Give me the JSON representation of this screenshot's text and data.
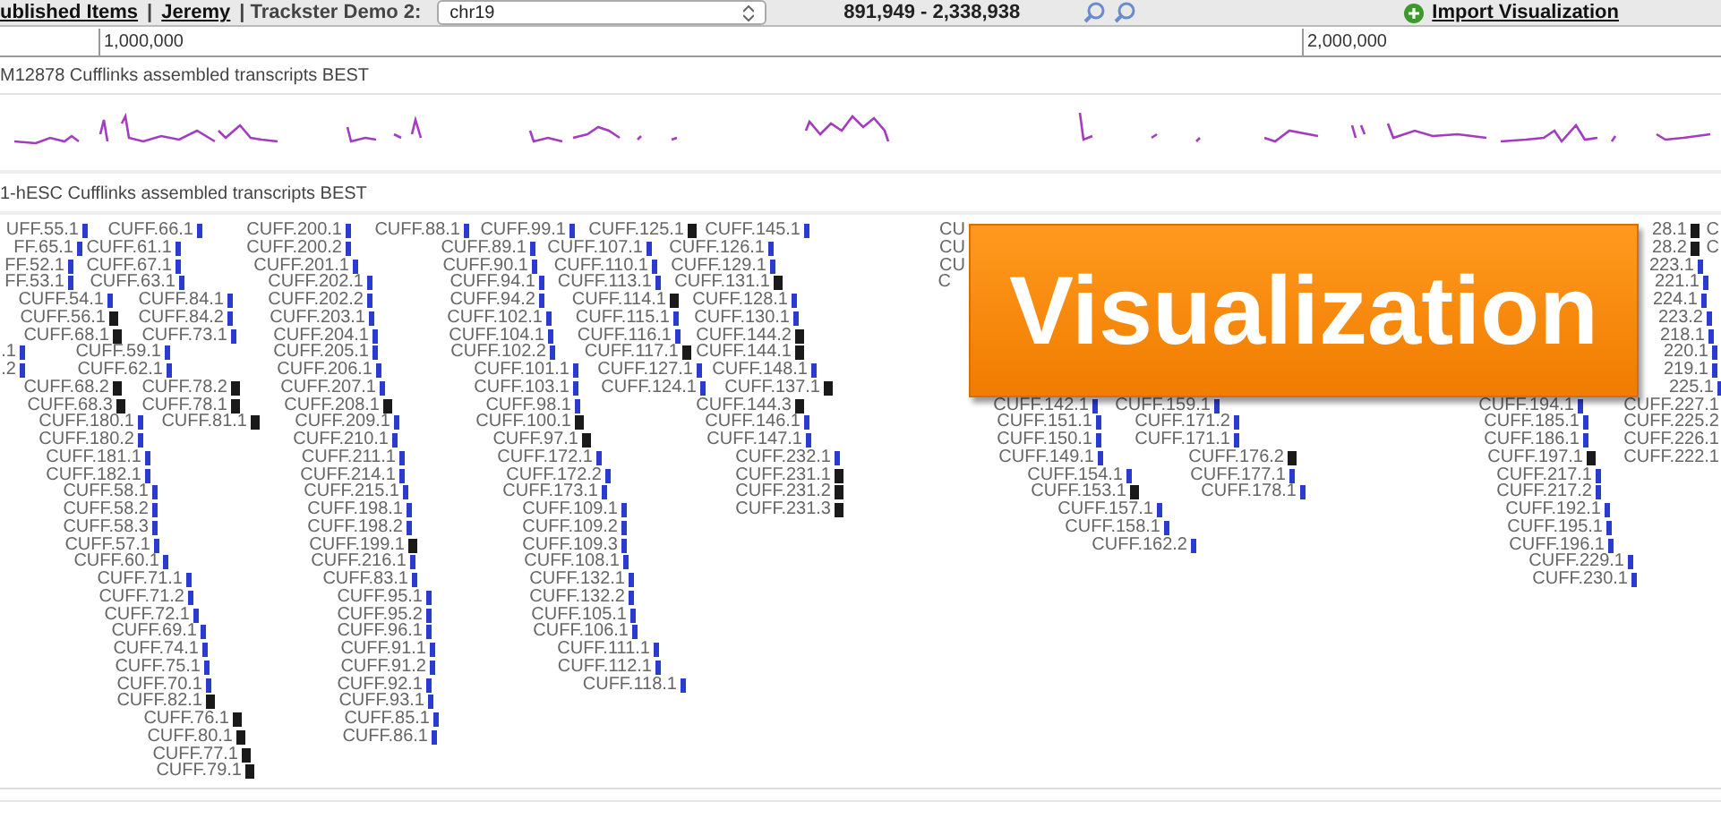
{
  "header": {
    "breadcrumbs": [
      {
        "text": "ublished Items",
        "link": true
      },
      {
        "text": "|",
        "link": false
      },
      {
        "text": "Jeremy",
        "link": true
      },
      {
        "text": "| Trackster Demo 2:",
        "link": false
      }
    ],
    "chromosome": "chr19",
    "range": "891,949 - 2,338,938",
    "import_link": "Import Visualization"
  },
  "ruler": {
    "ticks": [
      "1,000,000",
      "2,000,000"
    ]
  },
  "tracks": [
    {
      "kind": "coverage",
      "name": "M12878 Cufflinks assembled transcripts BEST"
    },
    {
      "kind": "features",
      "name": "1-hESC Cufflinks assembled transcripts BEST",
      "feature_columns": [
        [
          {
            "label": "UFF.55.1",
            "color": "#2a3bd0"
          },
          {
            "label": "FF.65.1",
            "color": "#2a3bd0"
          },
          {
            "label": "FF.52.1",
            "color": "#2a3bd0"
          },
          {
            "label": "FF.53.1",
            "color": "#2a3bd0"
          },
          {
            "label": "CUFF.54.1",
            "color": "#2a3bd0"
          },
          {
            "label": "CUFF.56.1",
            "color": "#1a1a1a"
          },
          {
            "label": "CUFF.68.1",
            "color": "#1a1a1a"
          },
          {
            "label": ".1",
            "color": "#2a3bd0"
          },
          {
            "label": ".2",
            "color": "#2a3bd0"
          },
          {
            "label": "CUFF.68.2",
            "color": "#1a1a1a"
          },
          {
            "label": "CUFF.68.3",
            "color": "#1a1a1a"
          },
          {
            "label": "CUFF.180.1",
            "color": "#2a3bd0"
          },
          {
            "label": "CUFF.180.2",
            "color": "#2a3bd0"
          },
          {
            "label": "CUFF.181.1",
            "color": "#2a3bd0"
          },
          {
            "label": "CUFF.182.1",
            "color": "#2a3bd0"
          },
          {
            "label": "CUFF.58.1",
            "color": "#2a3bd0"
          },
          {
            "label": "CUFF.58.2",
            "color": "#2a3bd0"
          },
          {
            "label": "CUFF.58.3",
            "color": "#2a3bd0"
          },
          {
            "label": "CUFF.57.1",
            "color": "#2a3bd0"
          },
          {
            "label": "CUFF.60.1",
            "color": "#2a3bd0"
          },
          {
            "label": "CUFF.71.1",
            "color": "#2a3bd0"
          },
          {
            "label": "CUFF.71.2",
            "color": "#2a3bd0"
          },
          {
            "label": "CUFF.72.1",
            "color": "#2a3bd0"
          },
          {
            "label": "CUFF.69.1",
            "color": "#2a3bd0"
          },
          {
            "label": "CUFF.74.1",
            "color": "#2a3bd0"
          },
          {
            "label": "CUFF.75.1",
            "color": "#2a3bd0"
          },
          {
            "label": "CUFF.70.1",
            "color": "#2a3bd0"
          },
          {
            "label": "CUFF.82.1",
            "color": "#1a1a1a"
          },
          {
            "label": "CUFF.76.1",
            "color": "#1a1a1a"
          },
          {
            "label": "CUFF.80.1",
            "color": "#1a1a1a"
          },
          {
            "label": "CUFF.77.1",
            "color": "#1a1a1a"
          },
          {
            "label": "CUFF.79.1",
            "color": "#1a1a1a"
          }
        ],
        [
          {
            "label": "CUFF.66.1",
            "color": "#2a3bd0"
          },
          {
            "label": "CUFF.61.1",
            "color": "#2a3bd0"
          },
          {
            "label": "CUFF.67.1",
            "color": "#2a3bd0"
          },
          {
            "label": "CUFF.63.1",
            "color": "#2a3bd0"
          },
          {
            "label": "CUFF.84.1",
            "color": "#2a3bd0"
          },
          {
            "label": "CUFF.84.2",
            "color": "#2a3bd0"
          },
          {
            "label": "CUFF.73.1",
            "color": "#2a3bd0"
          },
          {
            "label": "CUFF.59.1",
            "color": "#2a3bd0"
          },
          {
            "label": "CUFF.62.1",
            "color": "#2a3bd0"
          },
          {
            "label": "CUFF.78.2",
            "color": "#1a1a1a"
          },
          {
            "label": "CUFF.78.1",
            "color": "#1a1a1a"
          },
          {
            "label": "CUFF.81.1",
            "color": "#1a1a1a"
          }
        ],
        [
          {
            "label": "CUFF.200.1",
            "color": "#2a3bd0"
          },
          {
            "label": "CUFF.200.2",
            "color": "#2a3bd0"
          },
          {
            "label": "CUFF.201.1",
            "color": "#2a3bd0"
          },
          {
            "label": "CUFF.202.1",
            "color": "#2a3bd0"
          },
          {
            "label": "CUFF.202.2",
            "color": "#2a3bd0"
          },
          {
            "label": "CUFF.203.1",
            "color": "#2a3bd0"
          },
          {
            "label": "CUFF.204.1",
            "color": "#2a3bd0"
          },
          {
            "label": "CUFF.205.1",
            "color": "#2a3bd0"
          },
          {
            "label": "CUFF.206.1",
            "color": "#2a3bd0"
          },
          {
            "label": "CUFF.207.1",
            "color": "#2a3bd0"
          },
          {
            "label": "CUFF.208.1",
            "color": "#1a1a1a"
          },
          {
            "label": "CUFF.209.1",
            "color": "#2a3bd0"
          },
          {
            "label": "CUFF.210.1",
            "color": "#2a3bd0"
          },
          {
            "label": "CUFF.211.1",
            "color": "#2a3bd0"
          },
          {
            "label": "CUFF.214.1",
            "color": "#2a3bd0"
          },
          {
            "label": "CUFF.215.1",
            "color": "#2a3bd0"
          },
          {
            "label": "CUFF.198.1",
            "color": "#2a3bd0"
          },
          {
            "label": "CUFF.198.2",
            "color": "#2a3bd0"
          },
          {
            "label": "CUFF.199.1",
            "color": "#1a1a1a"
          },
          {
            "label": "CUFF.216.1",
            "color": "#2a3bd0"
          },
          {
            "label": "CUFF.83.1",
            "color": "#2a3bd0"
          },
          {
            "label": "CUFF.95.1",
            "color": "#2a3bd0"
          },
          {
            "label": "CUFF.95.2",
            "color": "#2a3bd0"
          },
          {
            "label": "CUFF.96.1",
            "color": "#2a3bd0"
          },
          {
            "label": "CUFF.91.1",
            "color": "#2a3bd0"
          },
          {
            "label": "CUFF.91.2",
            "color": "#2a3bd0"
          },
          {
            "label": "CUFF.92.1",
            "color": "#2a3bd0"
          },
          {
            "label": "CUFF.93.1",
            "color": "#2a3bd0"
          },
          {
            "label": "CUFF.85.1",
            "color": "#2a3bd0"
          },
          {
            "label": "CUFF.86.1",
            "color": "#2a3bd0"
          }
        ],
        [
          {
            "label": "CUFF.88.1",
            "color": "#2a3bd0"
          },
          {
            "label": "CUFF.89.1",
            "color": "#2a3bd0"
          },
          {
            "label": "CUFF.90.1",
            "color": "#2a3bd0"
          },
          {
            "label": "CUFF.94.1",
            "color": "#2a3bd0"
          },
          {
            "label": "CUFF.94.2",
            "color": "#2a3bd0"
          },
          {
            "label": "CUFF.102.1",
            "color": "#2a3bd0"
          },
          {
            "label": "CUFF.104.1",
            "color": "#2a3bd0"
          },
          {
            "label": "CUFF.102.2",
            "color": "#2a3bd0"
          },
          {
            "label": "CUFF.101.1",
            "color": "#2a3bd0"
          },
          {
            "label": "CUFF.103.1",
            "color": "#2a3bd0"
          },
          {
            "label": "CUFF.98.1",
            "color": "#2a3bd0"
          },
          {
            "label": "CUFF.100.1",
            "color": "#1a1a1a"
          },
          {
            "label": "CUFF.97.1",
            "color": "#1a1a1a"
          },
          {
            "label": "CUFF.172.1",
            "color": "#2a3bd0"
          },
          {
            "label": "CUFF.172.2",
            "color": "#2a3bd0"
          },
          {
            "label": "CUFF.173.1",
            "color": "#2a3bd0"
          },
          {
            "label": "CUFF.109.1",
            "color": "#2a3bd0"
          },
          {
            "label": "CUFF.109.2",
            "color": "#2a3bd0"
          },
          {
            "label": "CUFF.109.3",
            "color": "#2a3bd0"
          },
          {
            "label": "CUFF.108.1",
            "color": "#2a3bd0"
          },
          {
            "label": "CUFF.132.1",
            "color": "#2a3bd0"
          },
          {
            "label": "CUFF.132.2",
            "color": "#2a3bd0"
          },
          {
            "label": "CUFF.105.1",
            "color": "#2a3bd0"
          },
          {
            "label": "CUFF.106.1",
            "color": "#2a3bd0"
          },
          {
            "label": "CUFF.111.1",
            "color": "#2a3bd0"
          },
          {
            "label": "CUFF.112.1",
            "color": "#2a3bd0"
          },
          {
            "label": "CUFF.118.1",
            "color": "#2a3bd0"
          }
        ],
        [
          {
            "label": "CUFF.99.1",
            "color": "#2a3bd0"
          },
          {
            "label": "CUFF.107.1",
            "color": "#2a3bd0"
          },
          {
            "label": "CUFF.110.1",
            "color": "#2a3bd0"
          },
          {
            "label": "CUFF.113.1",
            "color": "#2a3bd0"
          },
          {
            "label": "CUFF.114.1",
            "color": "#1a1a1a"
          },
          {
            "label": "CUFF.115.1",
            "color": "#2a3bd0"
          },
          {
            "label": "CUFF.116.1",
            "color": "#2a3bd0"
          },
          {
            "label": "CUFF.117.1",
            "color": "#1a1a1a"
          },
          {
            "label": "CUFF.127.1",
            "color": "#2a3bd0"
          },
          {
            "label": "CUFF.124.1",
            "color": "#2a3bd0"
          }
        ],
        [
          {
            "label": "CUFF.125.1",
            "color": "#1a1a1a"
          }
        ],
        [
          {
            "label": "CUFF.145.1",
            "color": "#2a3bd0"
          },
          {
            "label": "CUFF.126.1",
            "color": "#2a3bd0"
          },
          {
            "label": "CUFF.129.1",
            "color": "#2a3bd0"
          },
          {
            "label": "CUFF.131.1",
            "color": "#1a1a1a"
          },
          {
            "label": "CUFF.128.1",
            "color": "#2a3bd0"
          },
          {
            "label": "CUFF.130.1",
            "color": "#2a3bd0"
          },
          {
            "label": "CUFF.144.2",
            "color": "#1a1a1a"
          },
          {
            "label": "CUFF.144.1",
            "color": "#1a1a1a"
          },
          {
            "label": "CUFF.148.1",
            "color": "#2a3bd0"
          },
          {
            "label": "CUFF.137.1",
            "color": "#1a1a1a"
          },
          {
            "label": "CUFF.144.3",
            "color": "#1a1a1a"
          },
          {
            "label": "CUFF.146.1",
            "color": "#2a3bd0"
          },
          {
            "label": "CUFF.147.1",
            "color": "#2a3bd0"
          },
          {
            "label": "CUFF.232.1",
            "color": "#2a3bd0"
          },
          {
            "label": "CUFF.231.1",
            "color": "#1a1a1a"
          },
          {
            "label": "CUFF.231.2",
            "color": "#1a1a1a"
          },
          {
            "label": "CUFF.231.3",
            "color": "#1a1a1a"
          }
        ],
        [
          {
            "label": "CU"
          },
          {
            "label": "CU"
          },
          {
            "label": "CU"
          },
          {
            "label": "C"
          }
        ],
        [
          {
            "label": "CUFF.142.1",
            "color": "#2a3bd0"
          },
          {
            "label": "CUFF.151.1",
            "color": "#2a3bd0"
          },
          {
            "label": "CUFF.150.1",
            "color": "#2a3bd0"
          },
          {
            "label": "CUFF.149.1",
            "color": "#2a3bd0"
          },
          {
            "label": "CUFF.154.1",
            "color": "#2a3bd0"
          },
          {
            "label": "CUFF.153.1",
            "color": "#1a1a1a"
          },
          {
            "label": "CUFF.157.1",
            "color": "#2a3bd0"
          },
          {
            "label": "CUFF.158.1",
            "color": "#2a3bd0"
          },
          {
            "label": "CUFF.162.2",
            "color": "#2a3bd0"
          }
        ],
        [
          {
            "label": "CUFF.159.1",
            "color": "#2a3bd0"
          },
          {
            "label": "CUFF.171.2",
            "color": "#2a3bd0"
          },
          {
            "label": "CUFF.171.1",
            "color": "#2a3bd0"
          },
          {
            "label": "CUFF.176.2",
            "color": "#1a1a1a"
          },
          {
            "label": "CUFF.177.1",
            "color": "#2a3bd0"
          },
          {
            "label": "CUFF.178.1",
            "color": "#2a3bd0"
          }
        ],
        [
          {
            "label": "CUFF.194.1",
            "color": "#2a3bd0"
          },
          {
            "label": "CUFF.185.1",
            "color": "#2a3bd0"
          },
          {
            "label": "CUFF.186.1",
            "color": "#2a3bd0"
          },
          {
            "label": "CUFF.197.1",
            "color": "#1a1a1a"
          },
          {
            "label": "CUFF.217.1",
            "color": "#2a3bd0"
          },
          {
            "label": "CUFF.217.2",
            "color": "#2a3bd0"
          },
          {
            "label": "CUFF.192.1",
            "color": "#2a3bd0"
          },
          {
            "label": "CUFF.195.1",
            "color": "#2a3bd0"
          },
          {
            "label": "CUFF.196.1",
            "color": "#2a3bd0"
          },
          {
            "label": "CUFF.229.1",
            "color": "#2a3bd0"
          },
          {
            "label": "CUFF.230.1",
            "color": "#2a3bd0"
          }
        ],
        [
          {
            "label": "28.1",
            "color": "#1a1a1a"
          },
          {
            "label": "28.2",
            "color": "#1a1a1a"
          },
          {
            "label": "223.1",
            "color": "#2a3bd0"
          },
          {
            "label": "221.1",
            "color": "#2a3bd0"
          },
          {
            "label": "224.1",
            "color": "#2a3bd0"
          },
          {
            "label": "223.2",
            "color": "#2a3bd0"
          },
          {
            "label": "218.1",
            "color": "#2a3bd0"
          },
          {
            "label": "220.1",
            "color": "#2a3bd0"
          },
          {
            "label": "219.1",
            "color": "#2a3bd0"
          },
          {
            "label": "225.1",
            "color": "#2a3bd0"
          },
          {
            "label": "CUFF.227.1"
          },
          {
            "label": "CUFF.225.2"
          },
          {
            "label": "CUFF.226.1"
          },
          {
            "label": "CUFF.222.1"
          }
        ],
        [
          {
            "label": "C"
          },
          {
            "label": "C"
          }
        ]
      ]
    }
  ],
  "overlay_label": "Visualization"
}
